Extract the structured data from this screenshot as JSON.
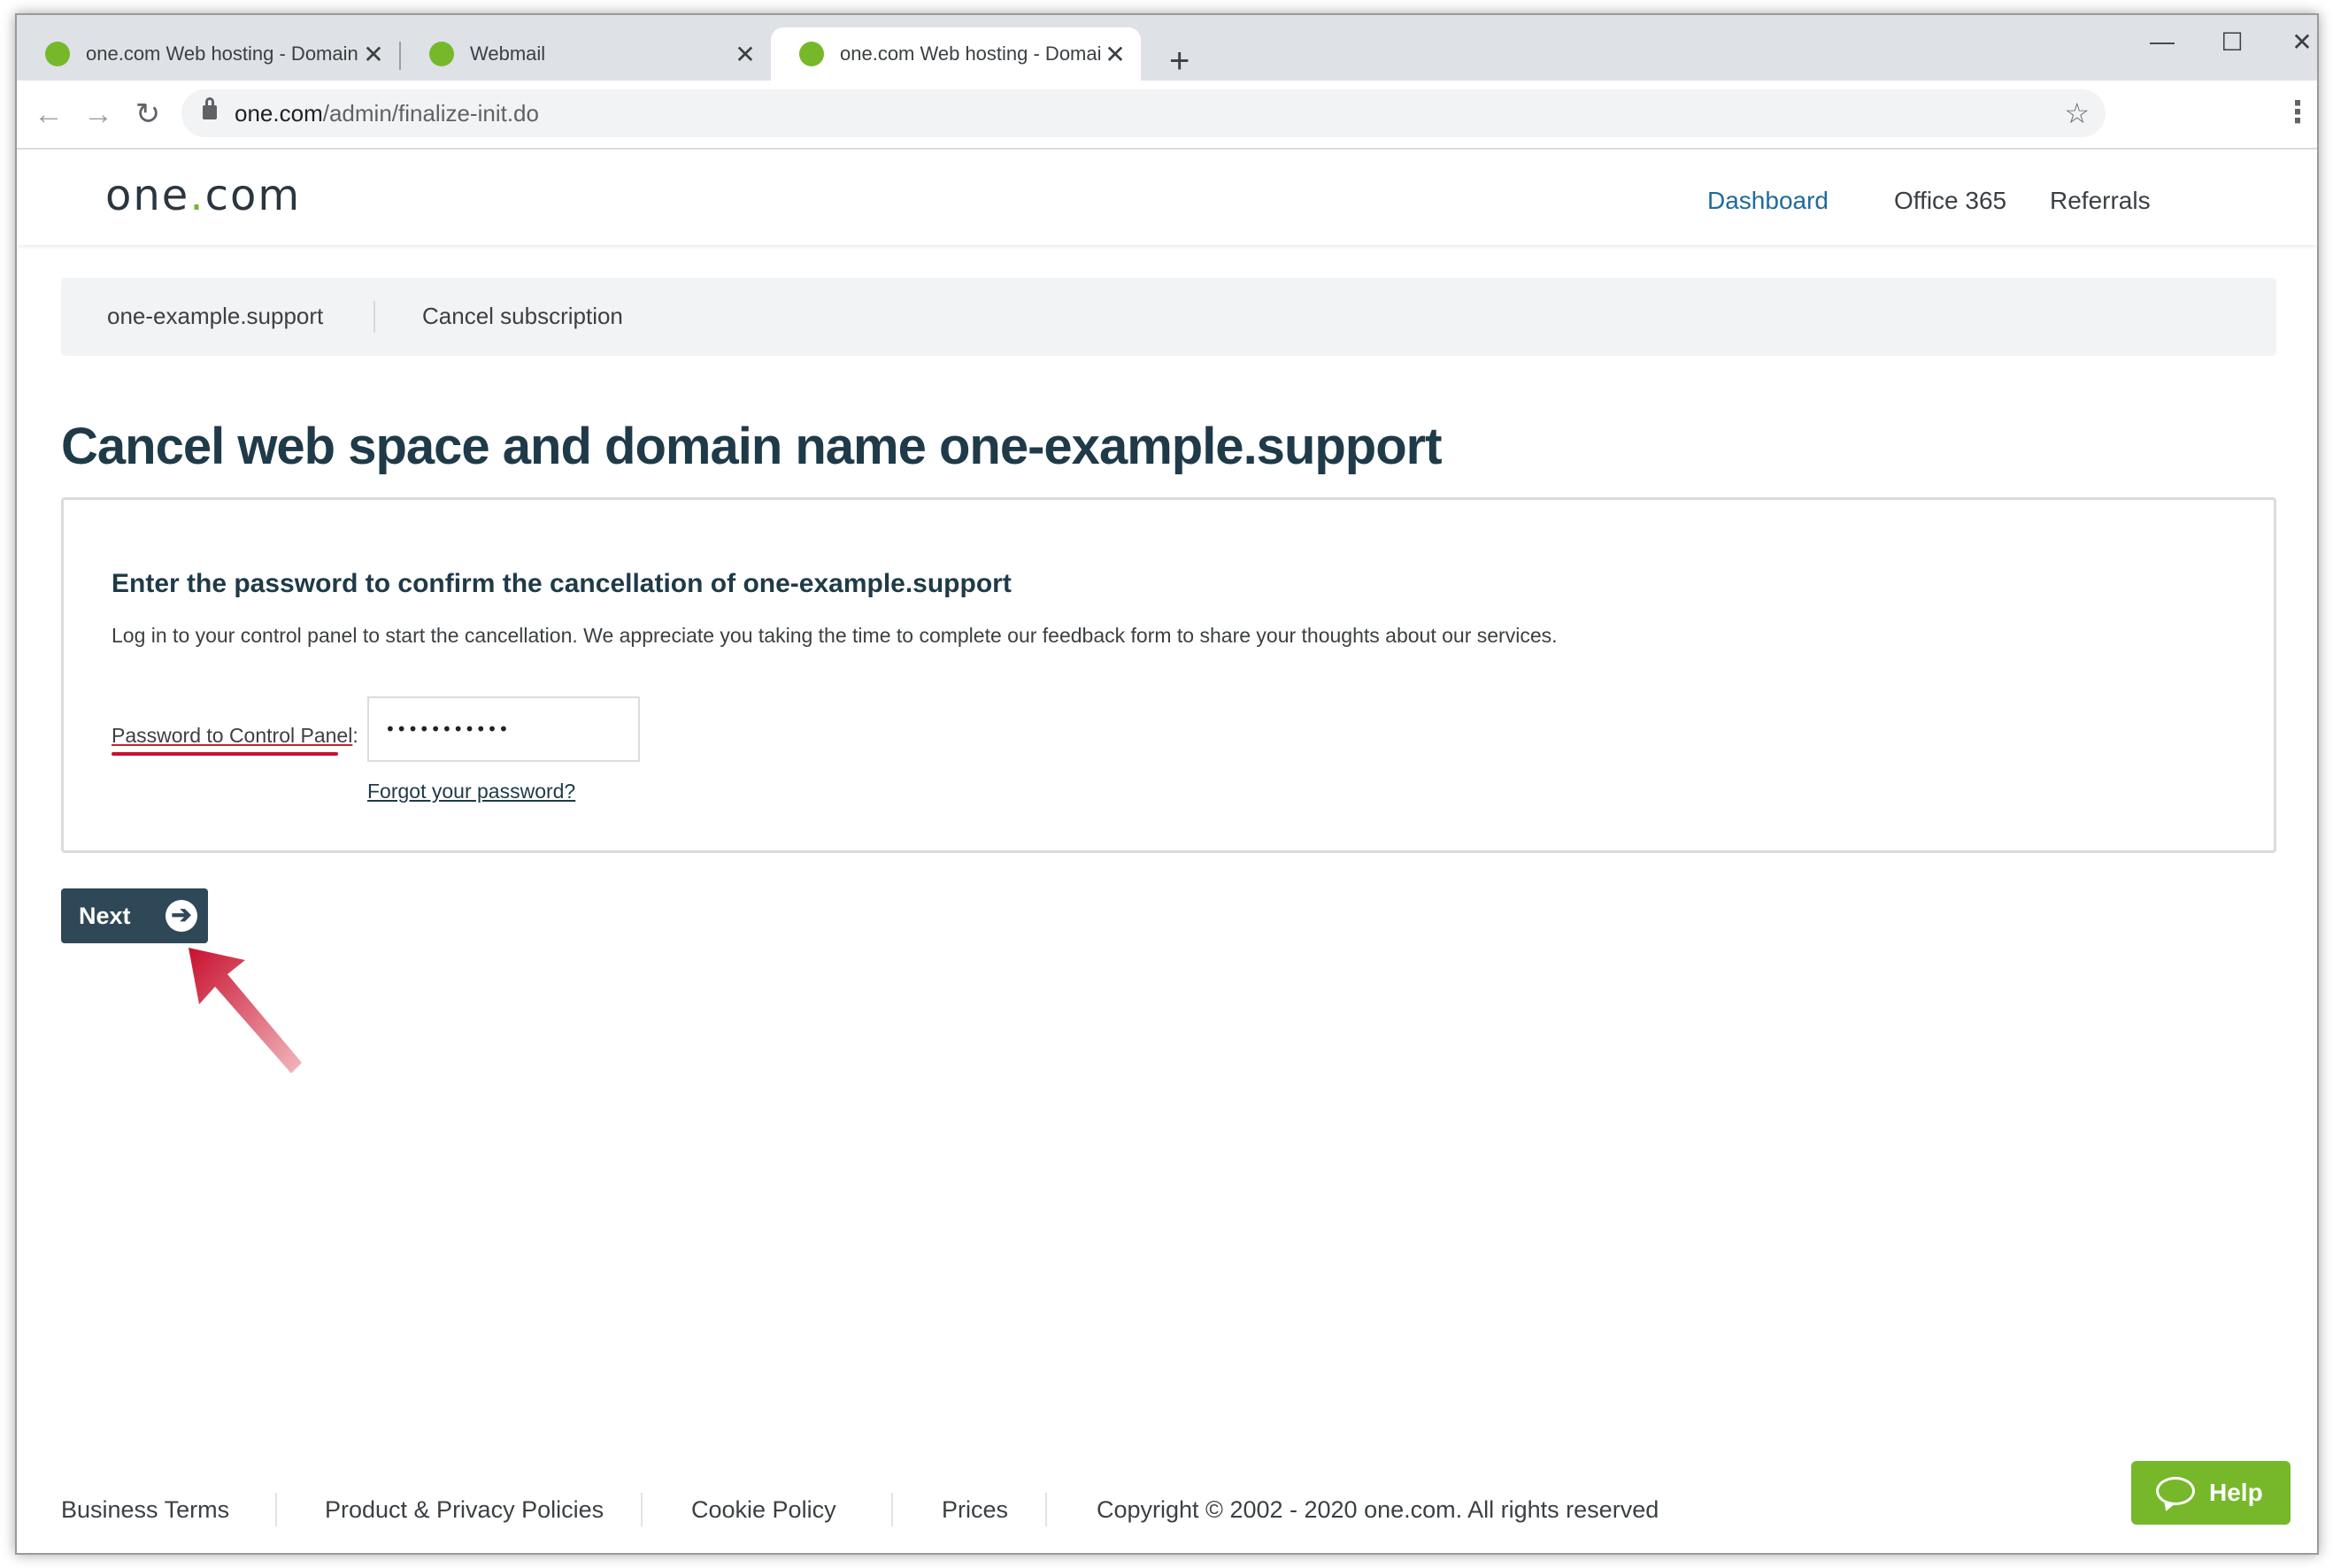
{
  "browser": {
    "tabs": [
      {
        "title": "one.com Web hosting  -  Domain",
        "close": "✕"
      },
      {
        "title": "Webmail",
        "close": "✕"
      },
      {
        "title": "one.com Web hosting  -  Domain",
        "close": "✕"
      }
    ],
    "new_tab": "+",
    "window_controls": {
      "minimize": "—",
      "maximize": "☐",
      "close": "✕"
    },
    "nav": {
      "back": "←",
      "forward": "→",
      "reload": "↻"
    },
    "url_host": "one.com",
    "url_path": "/admin/finalize-init.do",
    "bookmark_icon": "☆",
    "menu_icon": "⋮"
  },
  "site": {
    "logo_left": "one",
    "logo_dot": ".",
    "logo_right": "com",
    "nav": {
      "dashboard": "Dashboard",
      "office365": "Office 365",
      "referrals": "Referrals"
    }
  },
  "breadcrumb": {
    "domain": "one-example.support",
    "page": "Cancel subscription"
  },
  "page_title": "Cancel web space and domain name one-example.support",
  "form": {
    "heading": "Enter the password to confirm the cancellation of one-example.support",
    "description": "Log in to your control panel to start the cancellation. We appreciate you taking the time to complete our feedback form to share your thoughts about our services.",
    "password_label": "Password to Control Panel",
    "password_label_suffix": ":",
    "password_value": "•••••••••••",
    "forgot_link": "Forgot your password?"
  },
  "next_button": {
    "label": "Next",
    "icon": "➔"
  },
  "footer": {
    "business_terms": "Business Terms",
    "privacy": "Product & Privacy Policies",
    "cookie": "Cookie Policy",
    "prices": "Prices",
    "copyright": "Copyright © 2002 - 2020 one.com. All rights reserved"
  },
  "help_button": {
    "label": "Help"
  },
  "colors": {
    "brand_green": "#76b82a",
    "title_navy": "#1f3a48",
    "button_navy": "#2f4858",
    "active_link": "#1e6b9c",
    "annotation_red": "#c8102e"
  }
}
